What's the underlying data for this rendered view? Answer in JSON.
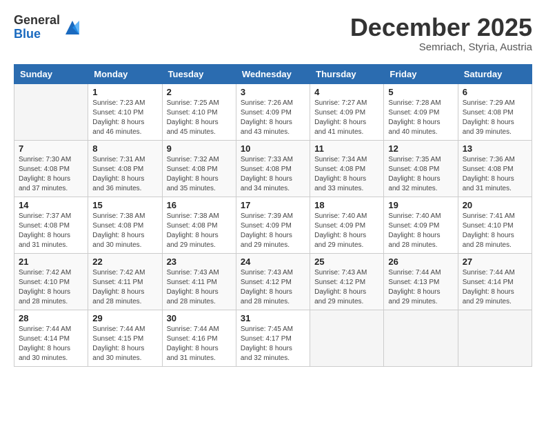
{
  "header": {
    "logo": {
      "line1": "General",
      "line2": "Blue"
    },
    "title": "December 2025",
    "location": "Semriach, Styria, Austria"
  },
  "weekdays": [
    "Sunday",
    "Monday",
    "Tuesday",
    "Wednesday",
    "Thursday",
    "Friday",
    "Saturday"
  ],
  "weeks": [
    [
      {
        "day": "",
        "info": ""
      },
      {
        "day": "1",
        "info": "Sunrise: 7:23 AM\nSunset: 4:10 PM\nDaylight: 8 hours\nand 46 minutes."
      },
      {
        "day": "2",
        "info": "Sunrise: 7:25 AM\nSunset: 4:10 PM\nDaylight: 8 hours\nand 45 minutes."
      },
      {
        "day": "3",
        "info": "Sunrise: 7:26 AM\nSunset: 4:09 PM\nDaylight: 8 hours\nand 43 minutes."
      },
      {
        "day": "4",
        "info": "Sunrise: 7:27 AM\nSunset: 4:09 PM\nDaylight: 8 hours\nand 41 minutes."
      },
      {
        "day": "5",
        "info": "Sunrise: 7:28 AM\nSunset: 4:09 PM\nDaylight: 8 hours\nand 40 minutes."
      },
      {
        "day": "6",
        "info": "Sunrise: 7:29 AM\nSunset: 4:08 PM\nDaylight: 8 hours\nand 39 minutes."
      }
    ],
    [
      {
        "day": "7",
        "info": "Sunrise: 7:30 AM\nSunset: 4:08 PM\nDaylight: 8 hours\nand 37 minutes."
      },
      {
        "day": "8",
        "info": "Sunrise: 7:31 AM\nSunset: 4:08 PM\nDaylight: 8 hours\nand 36 minutes."
      },
      {
        "day": "9",
        "info": "Sunrise: 7:32 AM\nSunset: 4:08 PM\nDaylight: 8 hours\nand 35 minutes."
      },
      {
        "day": "10",
        "info": "Sunrise: 7:33 AM\nSunset: 4:08 PM\nDaylight: 8 hours\nand 34 minutes."
      },
      {
        "day": "11",
        "info": "Sunrise: 7:34 AM\nSunset: 4:08 PM\nDaylight: 8 hours\nand 33 minutes."
      },
      {
        "day": "12",
        "info": "Sunrise: 7:35 AM\nSunset: 4:08 PM\nDaylight: 8 hours\nand 32 minutes."
      },
      {
        "day": "13",
        "info": "Sunrise: 7:36 AM\nSunset: 4:08 PM\nDaylight: 8 hours\nand 31 minutes."
      }
    ],
    [
      {
        "day": "14",
        "info": "Sunrise: 7:37 AM\nSunset: 4:08 PM\nDaylight: 8 hours\nand 31 minutes."
      },
      {
        "day": "15",
        "info": "Sunrise: 7:38 AM\nSunset: 4:08 PM\nDaylight: 8 hours\nand 30 minutes."
      },
      {
        "day": "16",
        "info": "Sunrise: 7:38 AM\nSunset: 4:08 PM\nDaylight: 8 hours\nand 29 minutes."
      },
      {
        "day": "17",
        "info": "Sunrise: 7:39 AM\nSunset: 4:09 PM\nDaylight: 8 hours\nand 29 minutes."
      },
      {
        "day": "18",
        "info": "Sunrise: 7:40 AM\nSunset: 4:09 PM\nDaylight: 8 hours\nand 29 minutes."
      },
      {
        "day": "19",
        "info": "Sunrise: 7:40 AM\nSunset: 4:09 PM\nDaylight: 8 hours\nand 28 minutes."
      },
      {
        "day": "20",
        "info": "Sunrise: 7:41 AM\nSunset: 4:10 PM\nDaylight: 8 hours\nand 28 minutes."
      }
    ],
    [
      {
        "day": "21",
        "info": "Sunrise: 7:42 AM\nSunset: 4:10 PM\nDaylight: 8 hours\nand 28 minutes."
      },
      {
        "day": "22",
        "info": "Sunrise: 7:42 AM\nSunset: 4:11 PM\nDaylight: 8 hours\nand 28 minutes."
      },
      {
        "day": "23",
        "info": "Sunrise: 7:43 AM\nSunset: 4:11 PM\nDaylight: 8 hours\nand 28 minutes."
      },
      {
        "day": "24",
        "info": "Sunrise: 7:43 AM\nSunset: 4:12 PM\nDaylight: 8 hours\nand 28 minutes."
      },
      {
        "day": "25",
        "info": "Sunrise: 7:43 AM\nSunset: 4:12 PM\nDaylight: 8 hours\nand 29 minutes."
      },
      {
        "day": "26",
        "info": "Sunrise: 7:44 AM\nSunset: 4:13 PM\nDaylight: 8 hours\nand 29 minutes."
      },
      {
        "day": "27",
        "info": "Sunrise: 7:44 AM\nSunset: 4:14 PM\nDaylight: 8 hours\nand 29 minutes."
      }
    ],
    [
      {
        "day": "28",
        "info": "Sunrise: 7:44 AM\nSunset: 4:14 PM\nDaylight: 8 hours\nand 30 minutes."
      },
      {
        "day": "29",
        "info": "Sunrise: 7:44 AM\nSunset: 4:15 PM\nDaylight: 8 hours\nand 30 minutes."
      },
      {
        "day": "30",
        "info": "Sunrise: 7:44 AM\nSunset: 4:16 PM\nDaylight: 8 hours\nand 31 minutes."
      },
      {
        "day": "31",
        "info": "Sunrise: 7:45 AM\nSunset: 4:17 PM\nDaylight: 8 hours\nand 32 minutes."
      },
      {
        "day": "",
        "info": ""
      },
      {
        "day": "",
        "info": ""
      },
      {
        "day": "",
        "info": ""
      }
    ]
  ]
}
